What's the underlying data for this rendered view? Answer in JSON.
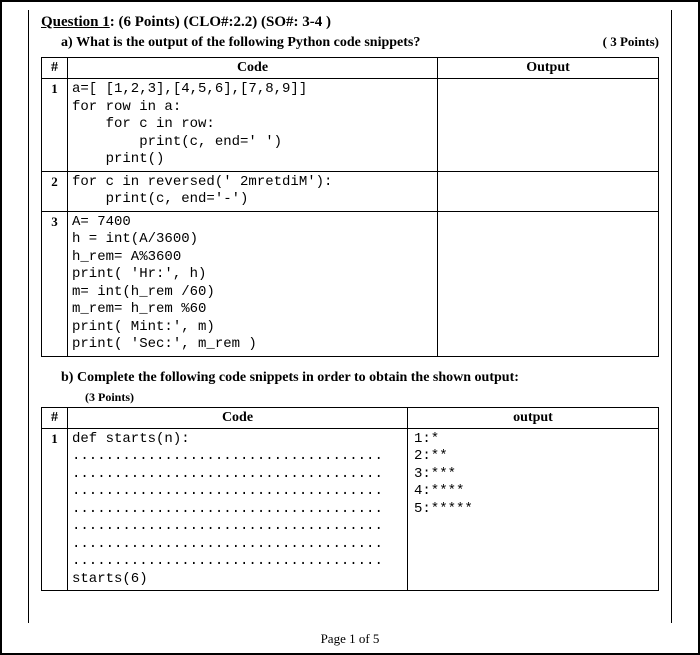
{
  "question": {
    "label": "Question 1",
    "meta": ": (6 Points) (CLO#:2.2) (SO#: 3-4 )"
  },
  "partA": {
    "label": "a)",
    "text": "What is the output of the following Python code snippets?",
    "points": "( 3 Points)",
    "headers": {
      "idx": "#",
      "code": "Code",
      "out": "Output"
    },
    "rows": [
      {
        "idx": "1",
        "code": "a=[ [1,2,3],[4,5,6],[7,8,9]]\nfor row in a:\n    for c in row:\n        print(c, end=' ')\n    print()",
        "out": ""
      },
      {
        "idx": "2",
        "code": "for c in reversed(' 2mretdiM'):\n    print(c, end='-')",
        "out": ""
      },
      {
        "idx": "3",
        "code": "A= 7400\nh = int(A/3600)\nh_rem= A%3600\nprint( 'Hr:', h)\nm= int(h_rem /60)\nm_rem= h_rem %60\nprint( Mint:', m)\nprint( 'Sec:', m_rem )",
        "out": ""
      }
    ]
  },
  "partB": {
    "label": "b)",
    "text": "Complete the following code snippets in order to obtain the shown output:",
    "points": "(3 Points)",
    "headers": {
      "idx": "#",
      "code": "Code",
      "out": "output"
    },
    "rows": [
      {
        "idx": "1",
        "code": "def starts(n):\n.....................................\n.....................................\n.....................................\n.....................................\n.....................................\n.....................................\n.....................................\nstarts(6)",
        "out": "1:*\n2:**\n3:***\n4:****\n5:*****"
      }
    ]
  },
  "footer": "Page 1 of 5"
}
